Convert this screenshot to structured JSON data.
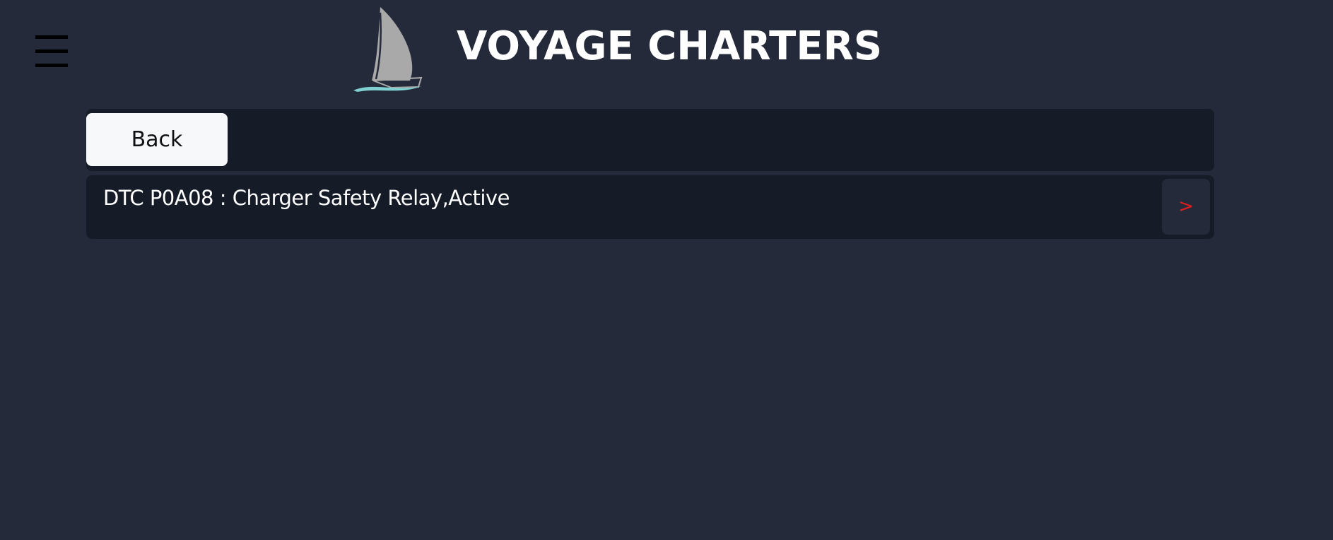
{
  "header": {
    "brand_title": "VOYAGE CHARTERS",
    "menu_icon": "hamburger-menu-icon",
    "logo_icon": "sailboat-logo"
  },
  "toolbar": {
    "back_label": "Back"
  },
  "dtc_list": [
    {
      "text": "DTC P0A08 : Charger Safety Relay,Active",
      "action_label": ">"
    }
  ],
  "colors": {
    "background": "#252a3b",
    "panel": "#161b28",
    "button": "#f6f8fa",
    "accent": "#e11d1d",
    "logo_sail": "#a9a9a9",
    "logo_wave": "#7fd1d1"
  }
}
